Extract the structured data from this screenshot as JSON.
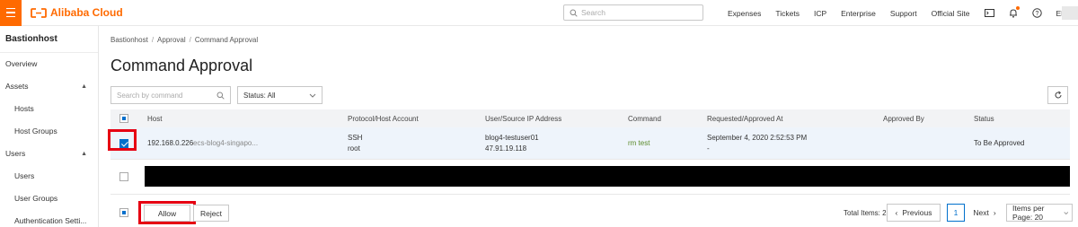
{
  "topbar": {
    "brand": "Alibaba Cloud",
    "search_placeholder": "Search",
    "nav": [
      "Expenses",
      "Tickets",
      "ICP",
      "Enterprise",
      "Support",
      "Official Site"
    ],
    "language": "EN",
    "accent": "#ff6a00"
  },
  "sidebar": {
    "title": "Bastionhost",
    "items": [
      {
        "label": "Overview"
      },
      {
        "label": "Assets"
      },
      {
        "label": "Hosts"
      },
      {
        "label": "Host Groups"
      },
      {
        "label": "Users"
      },
      {
        "label": "Users"
      },
      {
        "label": "User Groups"
      },
      {
        "label": "Authentication Setti..."
      }
    ]
  },
  "breadcrumb": [
    "Bastionhost",
    "Approval",
    "Command Approval"
  ],
  "page_title": "Command Approval",
  "filters": {
    "search_placeholder": "Search by command",
    "status_label": "Status: All"
  },
  "table": {
    "headers": [
      "Host",
      "Protocol/Host Account",
      "User/Source IP Address",
      "Command",
      "Requested/Approved At",
      "Approved By",
      "Status"
    ],
    "rows": [
      {
        "host_ip": "192.168.0.226",
        "host_name": "ecs-blog4-singapo...",
        "protocol": "SSH",
        "account": "root",
        "user": "blog4-testuser01",
        "source_ip": "47.91.19.118",
        "command": "rm test",
        "requested_at": "September 4, 2020 2:52:53 PM",
        "approved_at": "-",
        "approved_by": "",
        "status": "To Be Approved"
      }
    ]
  },
  "actions": {
    "allow": "Allow",
    "reject": "Reject"
  },
  "pagination": {
    "total": "Total Items: 2",
    "previous": "Previous",
    "current_page": "1",
    "next": "Next",
    "per_page": "Items per Page: 20"
  }
}
